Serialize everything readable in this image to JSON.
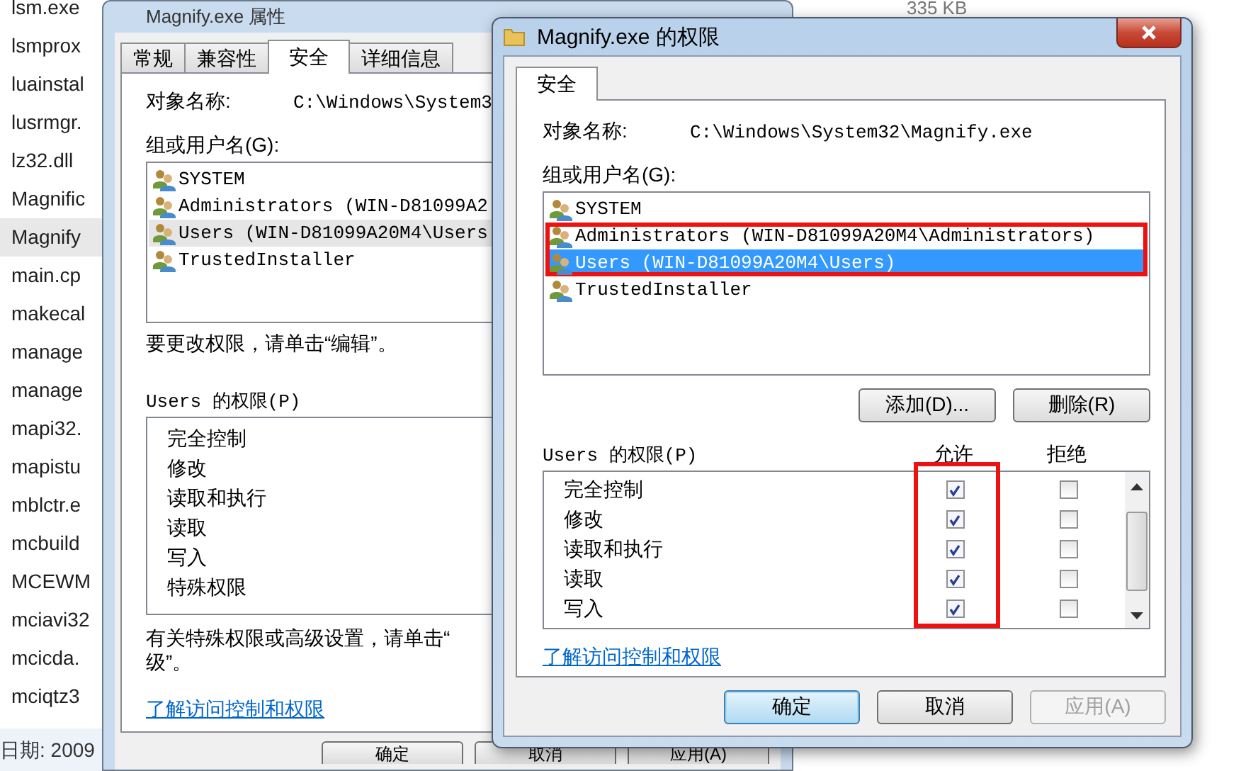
{
  "explorer": {
    "files": [
      {
        "name": "lsm.exe",
        "selected": false
      },
      {
        "name": "lsmprox",
        "selected": false
      },
      {
        "name": "luainstal",
        "selected": false
      },
      {
        "name": "lusrmgr.",
        "selected": false
      },
      {
        "name": "lz32.dll",
        "selected": false
      },
      {
        "name": "Magnific",
        "selected": false
      },
      {
        "name": "Magnify",
        "selected": true
      },
      {
        "name": "main.cp",
        "selected": false
      },
      {
        "name": "makecal",
        "selected": false
      },
      {
        "name": "manage",
        "selected": false
      },
      {
        "name": "manage",
        "selected": false
      },
      {
        "name": "mapi32.",
        "selected": false
      },
      {
        "name": "mapistu",
        "selected": false
      },
      {
        "name": "mblctr.e",
        "selected": false
      },
      {
        "name": "mcbuild",
        "selected": false
      },
      {
        "name": "MCEWM",
        "selected": false
      },
      {
        "name": "mciavi32",
        "selected": false
      },
      {
        "name": "mcicda.",
        "selected": false
      },
      {
        "name": "mciqtz3",
        "selected": false
      }
    ],
    "detail": "日期: 2009",
    "size": "335 KB"
  },
  "properties_dialog": {
    "title": "Magnify.exe 属性",
    "tabs": [
      {
        "label": "常规",
        "selected": false
      },
      {
        "label": "兼容性",
        "selected": false
      },
      {
        "label": "安全",
        "selected": true
      },
      {
        "label": "详细信息",
        "selected": false
      }
    ],
    "object_label": "对象名称:",
    "object_path": "C:\\Windows\\System3",
    "groups_label": "组或用户名(G):",
    "groups": [
      {
        "name": "SYSTEM",
        "selected": false
      },
      {
        "name": "Administrators (WIN-D81099A2",
        "selected": false
      },
      {
        "name": "Users (WIN-D81099A20M4\\Users",
        "selected": true
      },
      {
        "name": "TrustedInstaller",
        "selected": false
      }
    ],
    "edit_hint": "要更改权限，请单击“编辑”。",
    "permissions_label": "Users 的权限(P)",
    "permissions": [
      "完全控制",
      "修改",
      "读取和执行",
      "读取",
      "写入",
      "特殊权限"
    ],
    "advanced_hint": "有关特殊权限或高级设置，请单击“",
    "advanced_hint_2": "级”。",
    "link": "了解访问控制和权限",
    "buttons": [
      "确定",
      "取消",
      "应用(A)"
    ]
  },
  "permissions_dialog": {
    "title": "Magnify.exe 的权限",
    "tabs": [
      {
        "label": "安全",
        "selected": true
      }
    ],
    "object_label": "对象名称:",
    "object_path": "C:\\Windows\\System32\\Magnify.exe",
    "groups_label": "组或用户名(G):",
    "groups": [
      {
        "name": "SYSTEM",
        "selected": false,
        "highlighted": false
      },
      {
        "name": "Administrators (WIN-D81099A20M4\\Administrators)",
        "selected": false,
        "highlighted": true
      },
      {
        "name": "Users (WIN-D81099A20M4\\Users)",
        "selected": true,
        "highlighted": true
      },
      {
        "name": "TrustedInstaller",
        "selected": false,
        "highlighted": false
      }
    ],
    "add_button": "添加(D)...",
    "remove_button": "删除(R)",
    "permissions_label": "Users 的权限(P)",
    "allow_header": "允许",
    "deny_header": "拒绝",
    "permissions": [
      {
        "name": "完全控制",
        "allow": true,
        "deny": false
      },
      {
        "name": "修改",
        "allow": true,
        "deny": false
      },
      {
        "name": "读取和执行",
        "allow": true,
        "deny": false
      },
      {
        "name": "读取",
        "allow": true,
        "deny": false
      },
      {
        "name": "写入",
        "allow": true,
        "deny": false
      }
    ],
    "link": "了解访问控制和权限",
    "buttons": [
      {
        "label": "确定",
        "kind": "default"
      },
      {
        "label": "取消",
        "kind": "normal"
      },
      {
        "label": "应用(A)",
        "kind": "disabled"
      }
    ]
  }
}
